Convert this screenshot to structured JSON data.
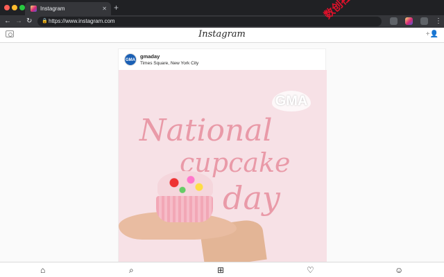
{
  "browser": {
    "tab_title": "Instagram",
    "tab_close": "✕",
    "new_tab": "+",
    "url": "https://www.instagram.com",
    "colors": {
      "red": "#ff5f57",
      "yellow": "#febc2e",
      "green": "#28c840"
    }
  },
  "header": {
    "logo": "Instagram"
  },
  "post": {
    "username": "gmaday",
    "location": "Times Square, New York City",
    "avatar_text": "GMA",
    "image": {
      "badge": "GMA",
      "line1": "National",
      "line2": "cupcake",
      "line3": "day"
    }
  },
  "watermark": "数创社scs66",
  "bottom_nav": {
    "items": [
      "home",
      "search",
      "new-post",
      "activity",
      "profile"
    ]
  }
}
